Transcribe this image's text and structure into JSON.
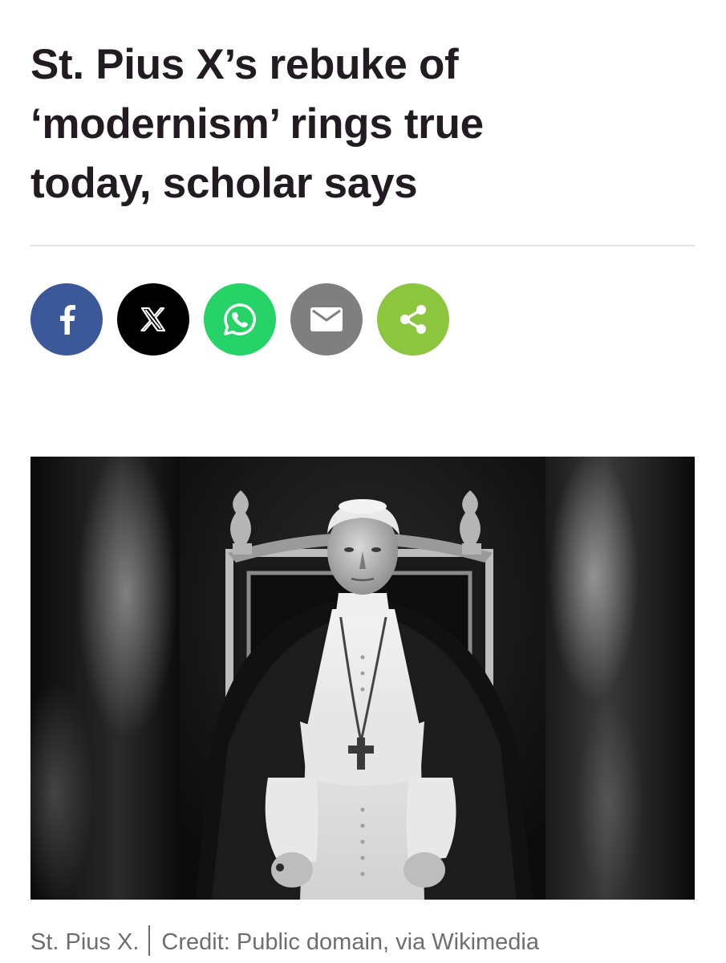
{
  "article": {
    "headline_line1": "St. Pius X’s rebuke of",
    "headline_line2": "‘modernism’ rings true",
    "headline_line3": "today, scholar says"
  },
  "share": {
    "buttons": [
      {
        "name": "facebook",
        "icon": "facebook-icon",
        "color": "#3b5998"
      },
      {
        "name": "x",
        "icon": "x-icon",
        "color": "#000000"
      },
      {
        "name": "whatsapp",
        "icon": "whatsapp-icon",
        "color": "#25d366"
      },
      {
        "name": "email",
        "icon": "mail-icon",
        "color": "#7f7f7f"
      },
      {
        "name": "share",
        "icon": "share-icon",
        "color": "#8cc63f"
      }
    ]
  },
  "photo": {
    "subject": "black-and-white portrait photograph"
  },
  "caption": {
    "subject": "St. Pius X.",
    "credit": "Credit: Public domain, via Wikimedia"
  }
}
